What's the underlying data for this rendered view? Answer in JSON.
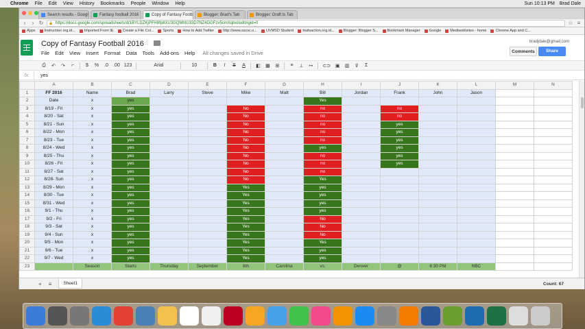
{
  "menubar": {
    "apple": "",
    "app": "Chrome",
    "items": [
      "File",
      "Edit",
      "View",
      "History",
      "Bookmarks",
      "People",
      "Window",
      "Help"
    ],
    "clock": "Sun 10:13 PM",
    "user": "Brad Dale"
  },
  "browser": {
    "tabs": [
      {
        "label": "Search results - Google",
        "color": "blue"
      },
      {
        "label": "Fantasy football 2016",
        "color": "green"
      },
      {
        "label": "Copy of Fantasy Football",
        "color": "green",
        "active": true
      },
      {
        "label": "Blogger: Brad's Tab",
        "color": "orange"
      },
      {
        "label": "Blogger: Draft Is Tab",
        "color": "orange"
      }
    ],
    "url": "https://docs.google.com/spreadsheets/d/1BYLDZKjPFH8fp8XU3GQMhtU33D7NZ4GGFzv5cmXqbxl/edit#gid=0",
    "bookmarks": [
      "Apps",
      "Instruction org.id...",
      "Imported From IE",
      "Create a File Col...",
      "Sports",
      "How to Add Twitter",
      "http://www.sscsc.o...",
      "UVMSD Student",
      "traitsaction.org.id...",
      "Blogger: Blogger S...",
      "Bookmark Manager",
      "Google",
      "Mediweblsites - home",
      "Chrome App and C..."
    ]
  },
  "sheets": {
    "title": "Copy of Fantasy Football 2016",
    "menus": [
      "File",
      "Edit",
      "View",
      "Insert",
      "Format",
      "Data",
      "Tools",
      "Add-ons",
      "Help"
    ],
    "saved_status": "All changes saved in Drive",
    "user_email": "bradjdale@gmail.com",
    "comments_label": "Comments",
    "share_label": "Share",
    "toolbar": {
      "font": "Arial",
      "size": "10",
      "currency": "$",
      "percent": "%",
      "decimals_less": ".0",
      "decimals_more": ".00",
      "format_more": "123",
      "bold": "B",
      "italic": "I",
      "strike": "S",
      "text_color": "A",
      "sigma": "Σ"
    },
    "formula_bar": {
      "fx": "fx",
      "value": "yes"
    },
    "sheet_tab": "Sheet1",
    "status": "Count: 67"
  },
  "grid": {
    "columns": [
      "",
      "A",
      "B",
      "C",
      "D",
      "E",
      "F",
      "G",
      "H",
      "I",
      "J",
      "K",
      "L",
      "M",
      "N"
    ],
    "header_row": [
      "FF 2016",
      "Name",
      "Brad",
      "Larry",
      "Steve",
      "Mike",
      "Matt",
      "Bill",
      "Jordan",
      "Frank",
      "John",
      "Jason"
    ],
    "rows": [
      {
        "n": "2",
        "date": "Date",
        "b": "x",
        "c": "yes",
        "f": "",
        "h": "Yes",
        "j": ""
      },
      {
        "n": "3",
        "date": "8/19 - Fri",
        "b": "x",
        "c": "yes",
        "f": "No",
        "h": "no",
        "j": "no"
      },
      {
        "n": "4",
        "date": "8/20 - Sat",
        "b": "x",
        "c": "yes",
        "f": "No",
        "h": "no",
        "j": "no"
      },
      {
        "n": "5",
        "date": "8/21 - Sun",
        "b": "x",
        "c": "yes",
        "f": "No",
        "h": "no",
        "j": "yes"
      },
      {
        "n": "6",
        "date": "8/22 - Mon",
        "b": "x",
        "c": "yes",
        "f": "No",
        "h": "no",
        "j": "yes"
      },
      {
        "n": "7",
        "date": "8/23 - Tue",
        "b": "x",
        "c": "yes",
        "f": "No",
        "h": "no",
        "j": "yes"
      },
      {
        "n": "8",
        "date": "8/24 - Wed",
        "b": "x",
        "c": "yes",
        "f": "No",
        "h": "yes",
        "j": "yes"
      },
      {
        "n": "9",
        "date": "8/25 - Thu",
        "b": "x",
        "c": "yes",
        "f": "No",
        "h": "no",
        "j": "yes"
      },
      {
        "n": "10",
        "date": "8/26 - Fri",
        "b": "x",
        "c": "yes",
        "f": "No",
        "h": "no",
        "j": "yes"
      },
      {
        "n": "11",
        "date": "8/27 - Sat",
        "b": "x",
        "c": "yes",
        "f": "No",
        "h": "no",
        "j": ""
      },
      {
        "n": "12",
        "date": "8/28- Sun",
        "b": "x",
        "c": "yes",
        "f": "No",
        "h": "Yes",
        "j": ""
      },
      {
        "n": "13",
        "date": "8/29 - Mon",
        "b": "x",
        "c": "yes",
        "f": "Yes",
        "h": "yes",
        "j": ""
      },
      {
        "n": "14",
        "date": "8/30 - Tue",
        "b": "x",
        "c": "yes",
        "f": "Yes",
        "h": "yes",
        "j": ""
      },
      {
        "n": "15",
        "date": "8/31 - Wed",
        "b": "x",
        "c": "yes",
        "f": "Yes",
        "h": "yes",
        "j": ""
      },
      {
        "n": "16",
        "date": "9/1 - Thu",
        "b": "x",
        "c": "yes",
        "f": "Yes",
        "h": "yes",
        "j": ""
      },
      {
        "n": "17",
        "date": "9/2 - Fri",
        "b": "x",
        "c": "yes",
        "f": "Yes",
        "h": "No",
        "j": ""
      },
      {
        "n": "18",
        "date": "9/3 - Sat",
        "b": "x",
        "c": "yes",
        "f": "Yes",
        "h": "No",
        "j": ""
      },
      {
        "n": "19",
        "date": "9/4 - Sun",
        "b": "x",
        "c": "yes",
        "f": "Yes",
        "h": "No",
        "j": ""
      },
      {
        "n": "20",
        "date": "9/5 - Mon",
        "b": "x",
        "c": "yes",
        "f": "Yes",
        "h": "Yes",
        "j": ""
      },
      {
        "n": "21",
        "date": "9/6 - Tue",
        "b": "x",
        "c": "yes",
        "f": "Yes",
        "h": "yes",
        "j": ""
      },
      {
        "n": "22",
        "date": "9/7 - Wed",
        "b": "x",
        "c": "yes",
        "f": "Yes",
        "h": "yes",
        "j": ""
      }
    ],
    "footer_row": {
      "n": "23",
      "cells": [
        "",
        "Season",
        "Starts",
        "Thursday",
        "September",
        "8th",
        "Carolina",
        "vs.",
        "Denver",
        "@",
        "8:30 PM",
        "NBC"
      ]
    },
    "colors": {
      "green": "#38761d",
      "red": "#e02020",
      "light_blue": "#dfe9f8",
      "footer_green": "#93c47d"
    }
  },
  "dock": {
    "icons": [
      "finder-icon",
      "launchpad-icon",
      "apps-grid-icon",
      "safari-icon",
      "chrome-icon",
      "preview-icon",
      "notes-icon",
      "calendar-icon",
      "reminders-icon",
      "photos-booth-icon",
      "photos-icon",
      "messages-icon",
      "facetime-icon",
      "itunes-icon",
      "ibooks-icon",
      "app-store-icon",
      "system-prefs-icon",
      "vlc-icon",
      "word-icon",
      "pineapple-icon",
      "dash-icon",
      "excel-icon",
      "keyboard-icon",
      "trash-icon"
    ]
  }
}
